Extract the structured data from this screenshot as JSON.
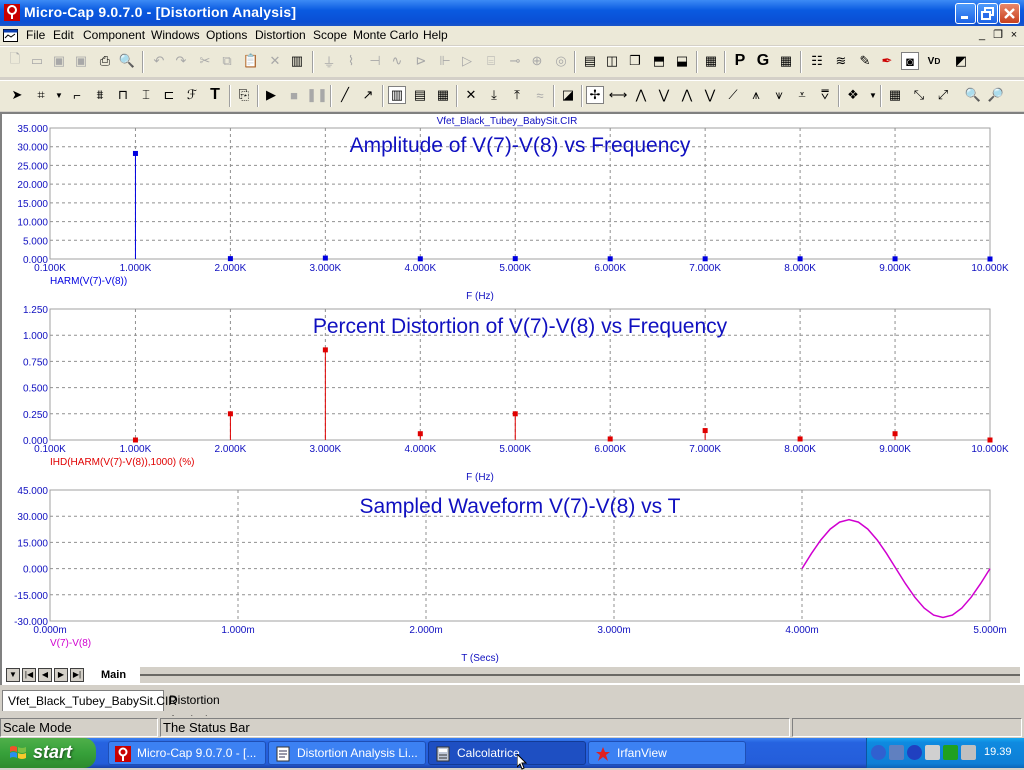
{
  "window": {
    "title": "Micro-Cap 9.0.7.0 - [Distortion Analysis]"
  },
  "menu": [
    "File",
    "Edit",
    "Component",
    "Windows",
    "Options",
    "Distortion",
    "Scope",
    "Monte Carlo",
    "Help"
  ],
  "mdi_controls": [
    "_",
    "❐",
    "×"
  ],
  "plot": {
    "file_name": "Vfet_Black_Tubey_BabySit.CIR",
    "sheet_tab": "Main"
  },
  "document_tabs": [
    "Vfet_Black_Tubey_BabySit.CIR",
    "Distortion Analysis"
  ],
  "status": {
    "mode": "Scale Mode",
    "message": "The Status Bar"
  },
  "taskbar": {
    "start_label": "start",
    "tasks": [
      "Micro-Cap 9.0.7.0 - [...",
      "Distortion Analysis Li...",
      "Calcolatrice",
      "IrfanView"
    ],
    "clock": "19.39"
  },
  "colors": {
    "amplitude": "#0000e0",
    "distortion": "#e00000",
    "waveform": "#d000d0",
    "title_blue": "#1010c0"
  },
  "chart_data": [
    {
      "type": "bar",
      "title": "Amplitude of V(7)-V(8) vs Frequency",
      "xlabel": "F (Hz)",
      "ylabel": "HARM(V(7)-V(8))",
      "x_ticks": [
        "0.100K",
        "1.000K",
        "2.000K",
        "3.000K",
        "4.000K",
        "5.000K",
        "6.000K",
        "7.000K",
        "8.000K",
        "9.000K",
        "10.000K"
      ],
      "y_ticks": [
        "0.000",
        "5.000",
        "10.000",
        "15.000",
        "20.000",
        "25.000",
        "30.000",
        "35.000"
      ],
      "xlim": [
        100,
        10000
      ],
      "ylim": [
        0,
        35
      ],
      "x": [
        1000,
        2000,
        3000,
        4000,
        5000,
        6000,
        7000,
        8000,
        9000,
        10000
      ],
      "values": [
        28.2,
        0.1,
        0.25,
        0.05,
        0.1,
        0.05,
        0.05,
        0.05,
        0.05,
        0.0
      ]
    },
    {
      "type": "bar",
      "title": "Percent Distortion of V(7)-V(8) vs Frequency",
      "xlabel": "F (Hz)",
      "ylabel": "IHD(HARM(V(7)-V(8)),1000) (%)",
      "x_ticks": [
        "0.100K",
        "1.000K",
        "2.000K",
        "3.000K",
        "4.000K",
        "5.000K",
        "6.000K",
        "7.000K",
        "8.000K",
        "9.000K",
        "10.000K"
      ],
      "y_ticks": [
        "0.000",
        "0.250",
        "0.500",
        "0.750",
        "1.000",
        "1.250"
      ],
      "xlim": [
        100,
        10000
      ],
      "ylim": [
        0,
        1.25
      ],
      "x": [
        1000,
        2000,
        3000,
        4000,
        5000,
        6000,
        7000,
        8000,
        9000,
        10000
      ],
      "values": [
        0.0,
        0.25,
        0.86,
        0.06,
        0.25,
        0.01,
        0.09,
        0.01,
        0.06,
        0.0
      ]
    },
    {
      "type": "line",
      "title": "Sampled Waveform  V(7)-V(8) vs T",
      "xlabel": "T (Secs)",
      "ylabel": "V(7)-V(8)",
      "x_ticks": [
        "0.000m",
        "1.000m",
        "2.000m",
        "3.000m",
        "4.000m",
        "5.000m"
      ],
      "y_ticks": [
        "-30.000",
        "-15.000",
        "0.000",
        "15.000",
        "30.000",
        "45.000"
      ],
      "xlim": [
        0,
        5
      ],
      "ylim": [
        -30,
        45
      ],
      "x": [
        4.0,
        4.05,
        4.1,
        4.15,
        4.2,
        4.25,
        4.3,
        4.35,
        4.4,
        4.45,
        4.5,
        4.55,
        4.6,
        4.65,
        4.7,
        4.75,
        4.8,
        4.85,
        4.9,
        4.95,
        5.0
      ],
      "y": [
        0.0,
        8.6,
        16.4,
        22.6,
        26.6,
        28.0,
        26.6,
        22.6,
        16.4,
        8.6,
        0.0,
        -8.6,
        -16.4,
        -22.6,
        -26.6,
        -28.0,
        -26.6,
        -22.6,
        -16.4,
        -8.6,
        0.0
      ]
    }
  ]
}
